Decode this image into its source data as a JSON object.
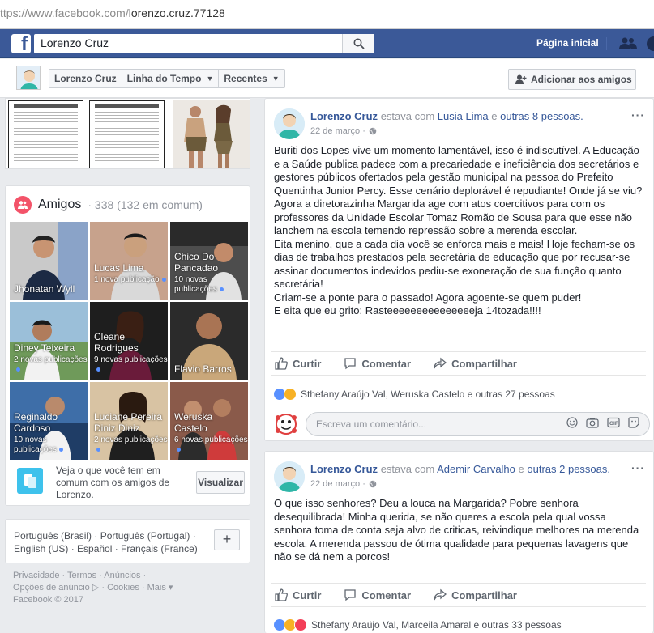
{
  "browser": {
    "url_prefix": "ttps://www.facebook.com/",
    "url_path": "lorenzo.cruz.77128"
  },
  "topbar": {
    "search_value": "Lorenzo Cruz",
    "home_label": "Página inicial",
    "logo": "f"
  },
  "profile_nav": {
    "name_tab": "Lorenzo Cruz",
    "timeline_tab": "Linha do Tempo",
    "recent_tab": "Recentes",
    "add_friend": "Adicionar aos amigos"
  },
  "friends": {
    "title": "Amigos",
    "count": "· 338 (132 em comum)",
    "items": [
      {
        "name": "Jhonatan Wyll",
        "sub": ""
      },
      {
        "name": "Lucas Lima",
        "sub": "1 nova publicação"
      },
      {
        "name": "Chico Do Pancadao",
        "sub": "10 novas publicações"
      },
      {
        "name": "Diney Teixeira",
        "sub": "2 novas publicações"
      },
      {
        "name": "Cleane Rodrigues",
        "sub": "9 novas publicações"
      },
      {
        "name": "Flavio Barros",
        "sub": ""
      },
      {
        "name": "Reginaldo Cardoso",
        "sub": "10 novas publicações"
      },
      {
        "name": "Luciane Pereira Diniz Diniz",
        "sub": "2 novas publicações"
      },
      {
        "name": "Weruska Castelo",
        "sub": "6 novas publicações"
      }
    ],
    "common_text": "Veja o que você tem em comum com os amigos de Lorenzo.",
    "view_button": "Visualizar"
  },
  "languages": {
    "line1": "Português (Brasil) · Português (Portugal) ·",
    "line2": "English (US) · Español · Français (France)",
    "plus": "+"
  },
  "footer": {
    "line1": "Privacidade · Termos · Anúncios ·",
    "line2": "Opções de anúncio ▷ · Cookies · Mais ▾",
    "line3": "Facebook © 2017"
  },
  "post1": {
    "author": "Lorenzo Cruz",
    "with_text": "estava com",
    "tagged": "Lusia Lima",
    "and_text": "e",
    "others": "outras 8 pessoas.",
    "date": "22 de março ·",
    "more": "···",
    "body": [
      "Buriti dos Lopes vive um momento lamentável, isso é indiscutível. A Educação e a Saúde publica padece com a precariedade e ineficiência dos secretários e gestores públicos ofertados pela gestão municipal na pessoa do Prefeito Quentinha Junior Percy. Esse cenário deplorável é repudiante! Onde já se viu? Agora a diretorazinha Margarida age com atos coercitivos para com os professores da Unidade Escolar Tomaz Romão de Sousa para que esse não lanchem na escola temendo repressão sobre a merenda escolar.",
      "Eita menino, que a cada dia você se enforca mais e mais! Hoje fecham-se os dias de trabalhos prestados pela secretária de educação que por recusar-se assinar documentos indevidos pediu-se exoneração de sua função quanto secretária!",
      "Criam-se a ponte para o passado! Agora agoente-se quem puder!",
      "E eita que eu grito: Rasteeeeeeeeeeeeeeeja 14tozada!!!!"
    ],
    "like": "Curtir",
    "comment": "Comentar",
    "share": "Compartilhar",
    "reactions": "Sthefany Araújo Val, Weruska Castelo e outras 27 pessoas",
    "comment_placeholder": "Escreva um comentário..."
  },
  "post2": {
    "author": "Lorenzo Cruz",
    "with_text": "estava com",
    "tagged": "Ademir Carvalho",
    "and_text": "e",
    "others": "outras 2 pessoas.",
    "date": "22 de março ·",
    "more": "···",
    "body": "O que isso senhores? Deu a louca na Margarida? Pobre senhora desequilibrada! Minha querida, se não queres a escola pela qual vossa senhora toma de conta seja alvo de criticas, reivindique melhores na merenda escola. A merenda passou de ótima qualidade para pequenas lavagens que não se dá nem a porcos!",
    "like": "Curtir",
    "comment": "Comentar",
    "share": "Compartilhar",
    "reactions": "Sthefany Araújo Val, Marceila Amaral e outras 33 pessoas"
  }
}
